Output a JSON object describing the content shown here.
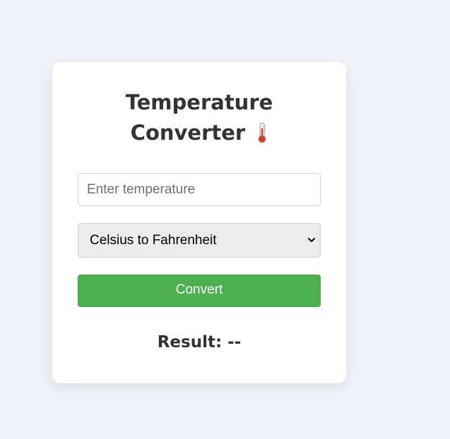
{
  "app": {
    "title_line1": "Temperature",
    "title_line2": "Converter",
    "title_icon": "thermometer-icon"
  },
  "form": {
    "input_placeholder": "Enter temperature",
    "input_value": "",
    "select_selected": "Celsius to Fahrenheit",
    "convert_label": "Convert"
  },
  "result": {
    "label": "Result: --"
  },
  "colors": {
    "page_background": "#eff2f7",
    "card_background": "#ffffff",
    "button_green": "#4caf50",
    "title_text": "#333333",
    "thermometer_red": "#d93a2b"
  }
}
